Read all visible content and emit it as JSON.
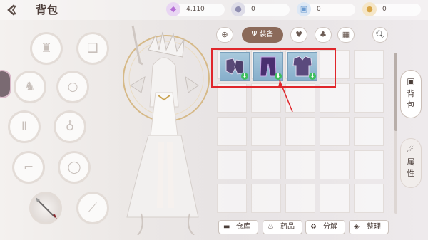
{
  "header": {
    "title": "背包",
    "back_icon": "back-arrow-icon"
  },
  "currencies": [
    {
      "icon": "purple-gem-icon",
      "value": "4,110",
      "color": "#b66fd6"
    },
    {
      "icon": "silver-coin-icon",
      "value": "0",
      "color": "#8e8db0"
    },
    {
      "icon": "blue-ticket-icon",
      "value": "0",
      "color": "#6b9bd1"
    },
    {
      "icon": "gold-coin-icon",
      "value": "0",
      "color": "#d8a545"
    }
  ],
  "filter_tabs": [
    {
      "icon": "all-items-icon",
      "label": "",
      "active": false
    },
    {
      "icon": "equipment-icon",
      "label": "装备",
      "active": true
    },
    {
      "icon": "heart-gem-icon",
      "label": "",
      "active": false
    },
    {
      "icon": "plant-icon",
      "label": "",
      "active": false
    },
    {
      "icon": "misc-grid-icon",
      "label": "",
      "active": false
    }
  ],
  "search": {
    "icon": "search-icon"
  },
  "inventory": {
    "items": [
      {
        "name": "gauntlets-item",
        "icon": "gauntlets",
        "upgrade": true
      },
      {
        "name": "pants-item",
        "icon": "pants",
        "upgrade": true
      },
      {
        "name": "chest-armor-item",
        "icon": "chest-armor",
        "upgrade": true
      }
    ]
  },
  "side_tabs": [
    {
      "label_top": "背",
      "label_bottom": "包",
      "icon": "backpack-icon",
      "active": true
    },
    {
      "label_top": "属",
      "label_bottom": "性",
      "icon": "attributes-icon",
      "active": false
    }
  ],
  "bottom_buttons": [
    {
      "label": "仓库",
      "icon": "warehouse-icon"
    },
    {
      "label": "药品",
      "icon": "potion-icon"
    },
    {
      "label": "分解",
      "icon": "recycle-icon"
    },
    {
      "label": "整理",
      "icon": "sort-stack-icon"
    }
  ]
}
